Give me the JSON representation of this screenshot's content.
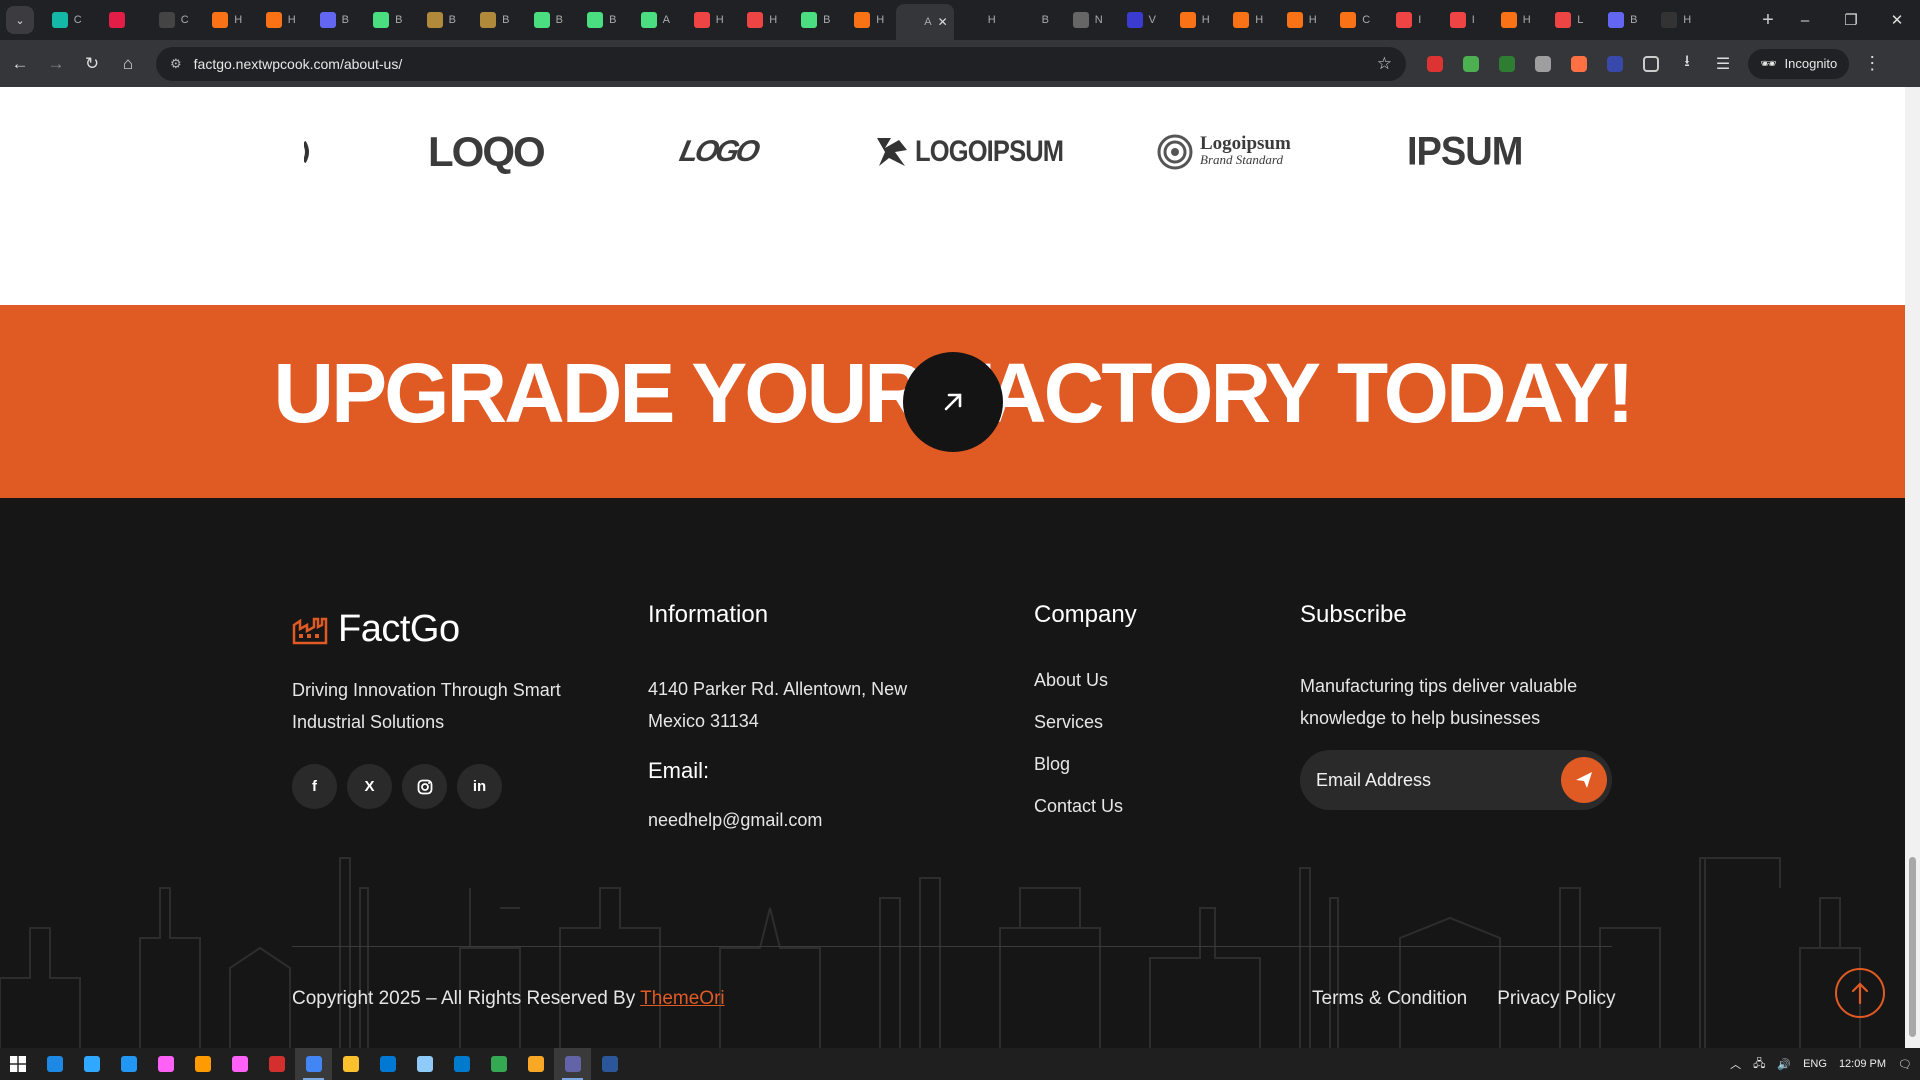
{
  "browser": {
    "tabs": [
      {
        "letter": "C",
        "color": "#14b8a6"
      },
      {
        "letter": "",
        "color": "#e11d48"
      },
      {
        "letter": "C",
        "color": "#444444"
      },
      {
        "letter": "H",
        "color": "#f97316"
      },
      {
        "letter": "H",
        "color": "#f97316"
      },
      {
        "letter": "B",
        "color": "#6366f1"
      },
      {
        "letter": "B",
        "color": "#4ade80"
      },
      {
        "letter": "B",
        "color": "#b08a3a"
      },
      {
        "letter": "B",
        "color": "#b08a3a"
      },
      {
        "letter": "B",
        "color": "#4ade80"
      },
      {
        "letter": "B",
        "color": "#4ade80"
      },
      {
        "letter": "A",
        "color": "#4ade80"
      },
      {
        "letter": "H",
        "color": "#ef4444"
      },
      {
        "letter": "H",
        "color": "#ef4444"
      },
      {
        "letter": "B",
        "color": "#4ade80"
      },
      {
        "letter": "H",
        "color": "#f97316"
      },
      {
        "letter": "A",
        "color": "#35363a",
        "active": true
      },
      {
        "letter": "H",
        "color": "#202124"
      },
      {
        "letter": "B",
        "color": "#202124"
      },
      {
        "letter": "N",
        "color": "#666666"
      },
      {
        "letter": "V",
        "color": "#3b3bd1"
      },
      {
        "letter": "H",
        "color": "#f97316"
      },
      {
        "letter": "H",
        "color": "#f97316"
      },
      {
        "letter": "H",
        "color": "#f97316"
      },
      {
        "letter": "C",
        "color": "#f97316"
      },
      {
        "letter": "I",
        "color": "#ef4444"
      },
      {
        "letter": "I",
        "color": "#ef4444"
      },
      {
        "letter": "H",
        "color": "#f97316"
      },
      {
        "letter": "L",
        "color": "#ef4444"
      },
      {
        "letter": "B",
        "color": "#6366f1"
      },
      {
        "letter": "H",
        "color": "#333333"
      }
    ],
    "url": "factgo.nextwpcook.com/about-us/",
    "incognito_label": "Incognito"
  },
  "partner_logos": [
    "LOQO",
    "LOGO",
    "LOGOIPSUM",
    "Logoipsum",
    "Brand Standard",
    "IPSUM"
  ],
  "cta": {
    "headline": "UPGRADE YOUR FACTORY TODAY!",
    "accent_color": "#e05a24"
  },
  "footer": {
    "brand": "FactGo",
    "tagline": "Driving Innovation Through Smart Industrial Solutions",
    "social": [
      "f",
      "X",
      "ig",
      "in"
    ],
    "information": {
      "heading": "Information",
      "address": "4140 Parker Rd. Allentown, New Mexico 31134",
      "email_label": "Email:",
      "email": "needhelp@gmail.com"
    },
    "company": {
      "heading": "Company",
      "links": [
        "About Us",
        "Services",
        "Blog",
        "Contact Us"
      ]
    },
    "subscribe": {
      "heading": "Subscribe",
      "text": "Manufacturing tips deliver valuable knowledge to help businesses",
      "placeholder": "Email Address"
    },
    "copyright_prefix": "Copyright 2025 – All Rights Reserved By",
    "copyright_link": "ThemeOri",
    "legal_links": [
      "Terms & Condition",
      "Privacy Policy"
    ]
  },
  "taskbar": {
    "apps": [
      "windows-start",
      "edge",
      "photoshop",
      "todo",
      "dreamweaver",
      "illustrator",
      "xd",
      "filezilla",
      "chrome",
      "sticky-notes",
      "outlook",
      "notepad",
      "vscode",
      "chrome-2",
      "file-explorer",
      "teams",
      "word"
    ],
    "tray_lang": "ENG",
    "clock": "12:09 PM"
  }
}
